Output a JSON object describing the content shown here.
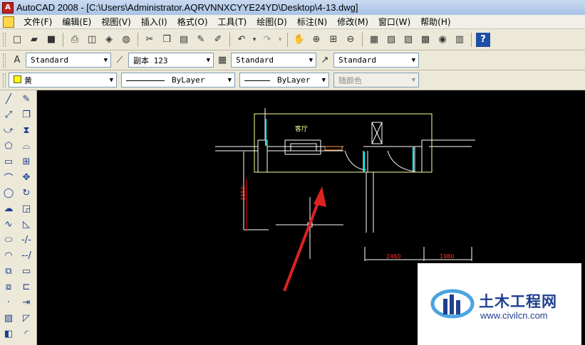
{
  "app": {
    "title": "AutoCAD 2008 - [C:\\Users\\Administrator.AQRVNNXCYYE24YD\\Desktop\\4-13.dwg]"
  },
  "menu": [
    "文件(F)",
    "编辑(E)",
    "视图(V)",
    "插入(I)",
    "格式(O)",
    "工具(T)",
    "绘图(D)",
    "标注(N)",
    "修改(M)",
    "窗口(W)",
    "帮助(H)"
  ],
  "styles_toolbar": {
    "text_style": "Standard",
    "dim_style": "副本 123",
    "table_style": "Standard",
    "multileader_style": "Standard"
  },
  "properties_toolbar": {
    "color": "黄",
    "color_hex": "#ffff00",
    "linetype": "ByLayer",
    "lineweight": "ByLayer",
    "plot_style": "随颜色"
  },
  "drawing": {
    "room_label": "客厅",
    "dim_vertical": "3850",
    "dim_horizontal_1": "2460",
    "dim_horizontal_2": "1980",
    "colors": {
      "background": "#000000",
      "lines": "#ffffff",
      "room_outline": "#ffff99",
      "dimension": "#ff0000",
      "cyan": "#00ffff",
      "orange": "#ff9933",
      "arrow": "#dd2222"
    }
  },
  "watermark": {
    "name": "土木工程网",
    "url": "www.civilcn.com",
    "brand_color": "#1f3f8f"
  }
}
